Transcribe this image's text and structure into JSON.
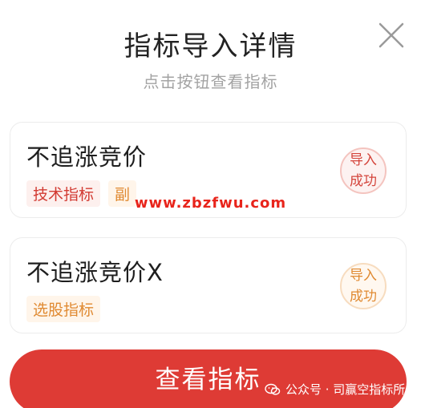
{
  "dialog": {
    "title": "指标导入详情",
    "subtitle": "点击按钮查看指标",
    "close_icon": "close-icon"
  },
  "cards": [
    {
      "name": "不追涨竞价",
      "tags": [
        "技术指标",
        "副"
      ],
      "status_line1": "导入",
      "status_line2": "成功"
    },
    {
      "name": "不追涨竞价X",
      "tags": [
        "选股指标"
      ],
      "status_line1": "导入",
      "status_line2": "成功"
    }
  ],
  "watermark": "www.zbzfwu.com",
  "primary_button": {
    "label": "查看指标"
  },
  "credit": {
    "text": "公众号 · 司赢空指标所",
    "icon": "wechat-icon"
  },
  "colors": {
    "accent_red": "#de3b35",
    "tag_red": "#d23a32",
    "tag_orange": "#e08a32"
  }
}
